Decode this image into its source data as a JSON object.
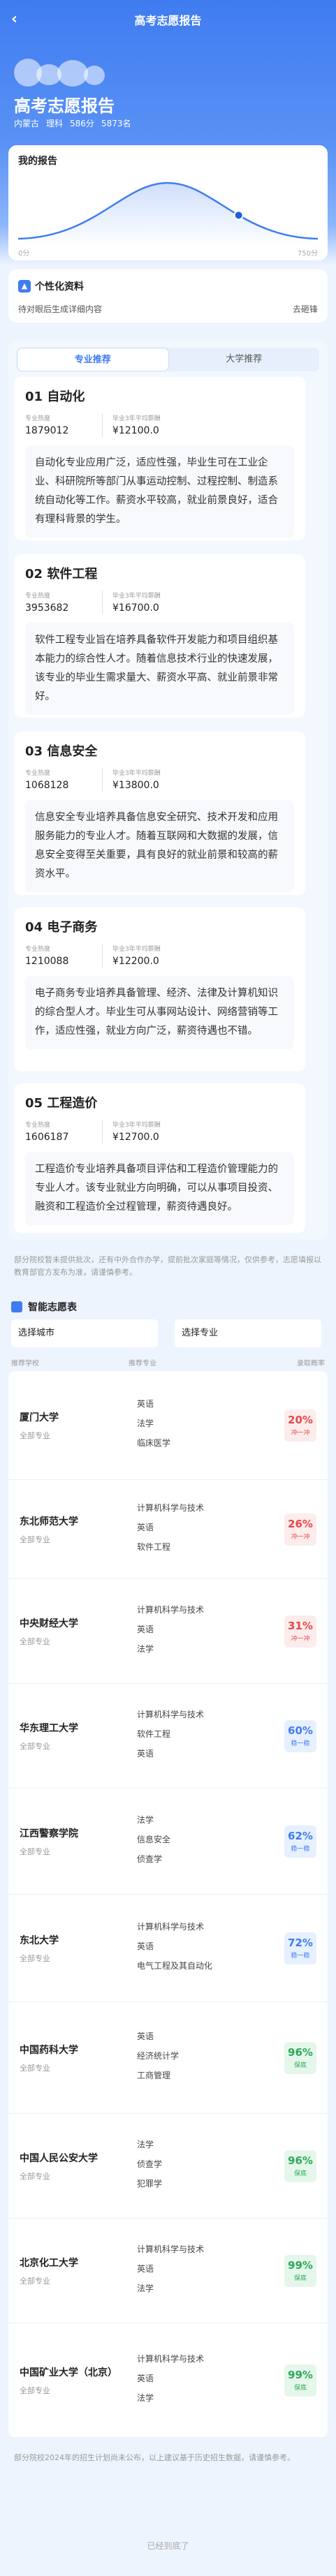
{
  "nav": {
    "title": "高考志愿报告",
    "back_icon": "chevron-left-icon"
  },
  "report": {
    "title": "高考志愿报告",
    "province": "内蒙古",
    "subject": "理科",
    "score": "586分",
    "rank": "5873名"
  },
  "chart_card": {
    "title": "我的报告",
    "left_label": "0分",
    "right_label": "750分",
    "marker_fraction": 0.78
  },
  "profile": {
    "icon": "person-icon",
    "title": "个性化资料",
    "subtitle": "待对眼后生成详细内容",
    "button": "去砸锋"
  },
  "tabs": [
    {
      "label": "专业推荐"
    },
    {
      "label": "大学推荐"
    }
  ],
  "majors": [
    {
      "title": "01 自动化",
      "heat_label": "专业热度",
      "heat": "1879012",
      "salary_label": "毕业3年平均薪酬",
      "salary": "¥12100.0",
      "desc": "自动化专业应用广泛，适应性强，毕业生可在工业企业、科研院所等部门从事运动控制、过程控制、制造系统自动化等工作。薪资水平较高，就业前景良好，适合有理科背景的学生。"
    },
    {
      "title": "02 软件工程",
      "heat_label": "专业热度",
      "heat": "3953682",
      "salary_label": "毕业3年平均薪酬",
      "salary": "¥16700.0",
      "desc": "软件工程专业旨在培养具备软件开发能力和项目组织基本能力的综合性人才。随着信息技术行业的快速发展，该专业的毕业生需求量大、薪资水平高、就业前景非常好。"
    },
    {
      "title": "03 信息安全",
      "heat_label": "专业热度",
      "heat": "1068128",
      "salary_label": "毕业3年平均薪酬",
      "salary": "¥13800.0",
      "desc": "信息安全专业培养具备信息安全研究、技术开发和应用服务能力的专业人才。随着互联网和大数据的发展，信息安全变得至关重要，具有良好的就业前景和较高的薪资水平。"
    },
    {
      "title": "04 电子商务",
      "heat_label": "专业热度",
      "heat": "1210088",
      "salary_label": "毕业3年平均薪酬",
      "salary": "¥12200.0",
      "desc": "电子商务专业培养具备管理、经济、法律及计算机知识的综合型人才。毕业生可从事网站设计、网络营销等工作，适应性强，就业方向广泛，薪资待遇也不错。"
    },
    {
      "title": "05 工程造价",
      "heat_label": "专业热度",
      "heat": "1606187",
      "salary_label": "毕业3年平均薪酬",
      "salary": "¥12700.0",
      "desc": "工程造价专业培养具备项目评估和工程造价管理能力的专业人才。该专业就业方向明确，可以从事项目投资、融资和工程造价全过程管理，薪资待遇良好。"
    }
  ],
  "notice1": "部分院校暂未提供批次，还有中外合作办学，提前批次家庭等情况，仅供参考，志愿填报以教育部官方发布为准，请谨慎参考。",
  "smart": {
    "icon": "table-icon",
    "title": "智能志愿表",
    "city_select": "选择城市",
    "major_select": "选择专业"
  },
  "table_head": {
    "school": "推荐学校",
    "major": "推荐专业",
    "rate": "录取概率"
  },
  "schools": [
    {
      "name": "厦门大学",
      "all": "全部专业",
      "majors": [
        "英语",
        "法学",
        "临床医学"
      ],
      "pct": "20%",
      "kind": "冲一冲",
      "tone": "red"
    },
    {
      "name": "东北师范大学",
      "all": "全部专业",
      "majors": [
        "计算机科学与技术",
        "英语",
        "软件工程"
      ],
      "pct": "26%",
      "kind": "冲一冲",
      "tone": "red"
    },
    {
      "name": "中央财经大学",
      "all": "全部专业",
      "majors": [
        "计算机科学与技术",
        "英语",
        "法学"
      ],
      "pct": "31%",
      "kind": "冲一冲",
      "tone": "red"
    },
    {
      "name": "华东理工大学",
      "all": "全部专业",
      "majors": [
        "计算机科学与技术",
        "软件工程",
        "英语"
      ],
      "pct": "60%",
      "kind": "稳一稳",
      "tone": "blue"
    },
    {
      "name": "江西警察学院",
      "all": "全部专业",
      "majors": [
        "法学",
        "信息安全",
        "侦查学"
      ],
      "pct": "62%",
      "kind": "稳一稳",
      "tone": "blue"
    },
    {
      "name": "东北大学",
      "all": "全部专业",
      "majors": [
        "计算机科学与技术",
        "英语",
        "电气工程及其自动化"
      ],
      "pct": "72%",
      "kind": "稳一稳",
      "tone": "blue"
    },
    {
      "name": "中国药科大学",
      "all": "全部专业",
      "majors": [
        "英语",
        "经济统计学",
        "工商管理"
      ],
      "pct": "96%",
      "kind": "保底",
      "tone": "green"
    },
    {
      "name": "中国人民公安大学",
      "all": "全部专业",
      "majors": [
        "法学",
        "侦查学",
        "犯罪学"
      ],
      "pct": "96%",
      "kind": "保底",
      "tone": "green"
    },
    {
      "name": "北京化工大学",
      "all": "全部专业",
      "majors": [
        "计算机科学与技术",
        "英语",
        "法学"
      ],
      "pct": "99%",
      "kind": "保底",
      "tone": "green"
    },
    {
      "name": "中国矿业大学（北京）",
      "all": "全部专业",
      "majors": [
        "计算机科学与技术",
        "英语",
        "法学"
      ],
      "pct": "99%",
      "kind": "保底",
      "tone": "green"
    }
  ],
  "notice2": "部分院校2024年的招生计划尚未公布，以上建议基于历史招生数据，请谨慎参考。",
  "end": "已经到底了"
}
